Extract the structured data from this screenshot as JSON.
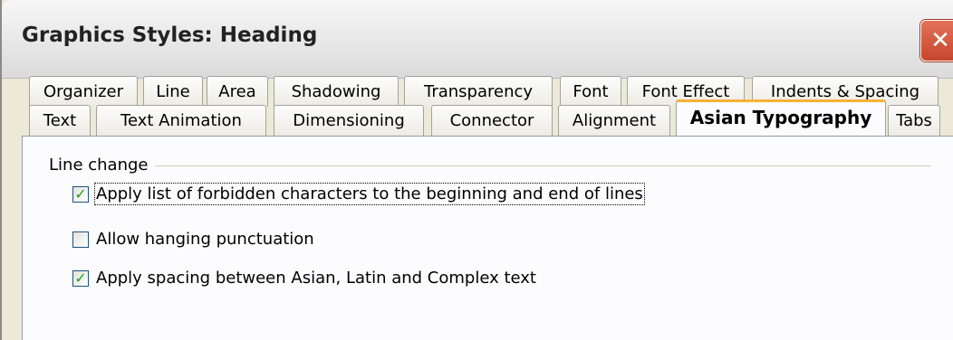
{
  "window": {
    "title": "Graphics Styles: Heading",
    "close_glyph": "✕"
  },
  "tabs_row1": [
    {
      "label": "Organizer"
    },
    {
      "label": "Line"
    },
    {
      "label": "Area"
    },
    {
      "label": "Shadowing"
    },
    {
      "label": "Transparency"
    },
    {
      "label": "Font"
    },
    {
      "label": "Font Effect"
    },
    {
      "label": "Indents & Spacing"
    }
  ],
  "tabs_row2": [
    {
      "label": "Text"
    },
    {
      "label": "Text Animation"
    },
    {
      "label": "Dimensioning"
    },
    {
      "label": "Connector"
    },
    {
      "label": "Alignment"
    },
    {
      "label": "Asian Typography"
    },
    {
      "label": "Tabs"
    }
  ],
  "active_tab": "Asian Typography",
  "line_change": {
    "label": "Line change",
    "options": [
      {
        "label": "Apply list of forbidden characters to the beginning and end of lines",
        "checked": true,
        "check_glyph": "✓"
      },
      {
        "label": "Allow hanging punctuation",
        "checked": false,
        "check_glyph": ""
      },
      {
        "label": "Apply spacing between Asian, Latin and Complex text",
        "checked": true,
        "check_glyph": "✓"
      }
    ]
  },
  "colors": {
    "active_tab_accent": "#f5b339",
    "check_mark": "#21a121",
    "close_button": "#c5472c"
  }
}
